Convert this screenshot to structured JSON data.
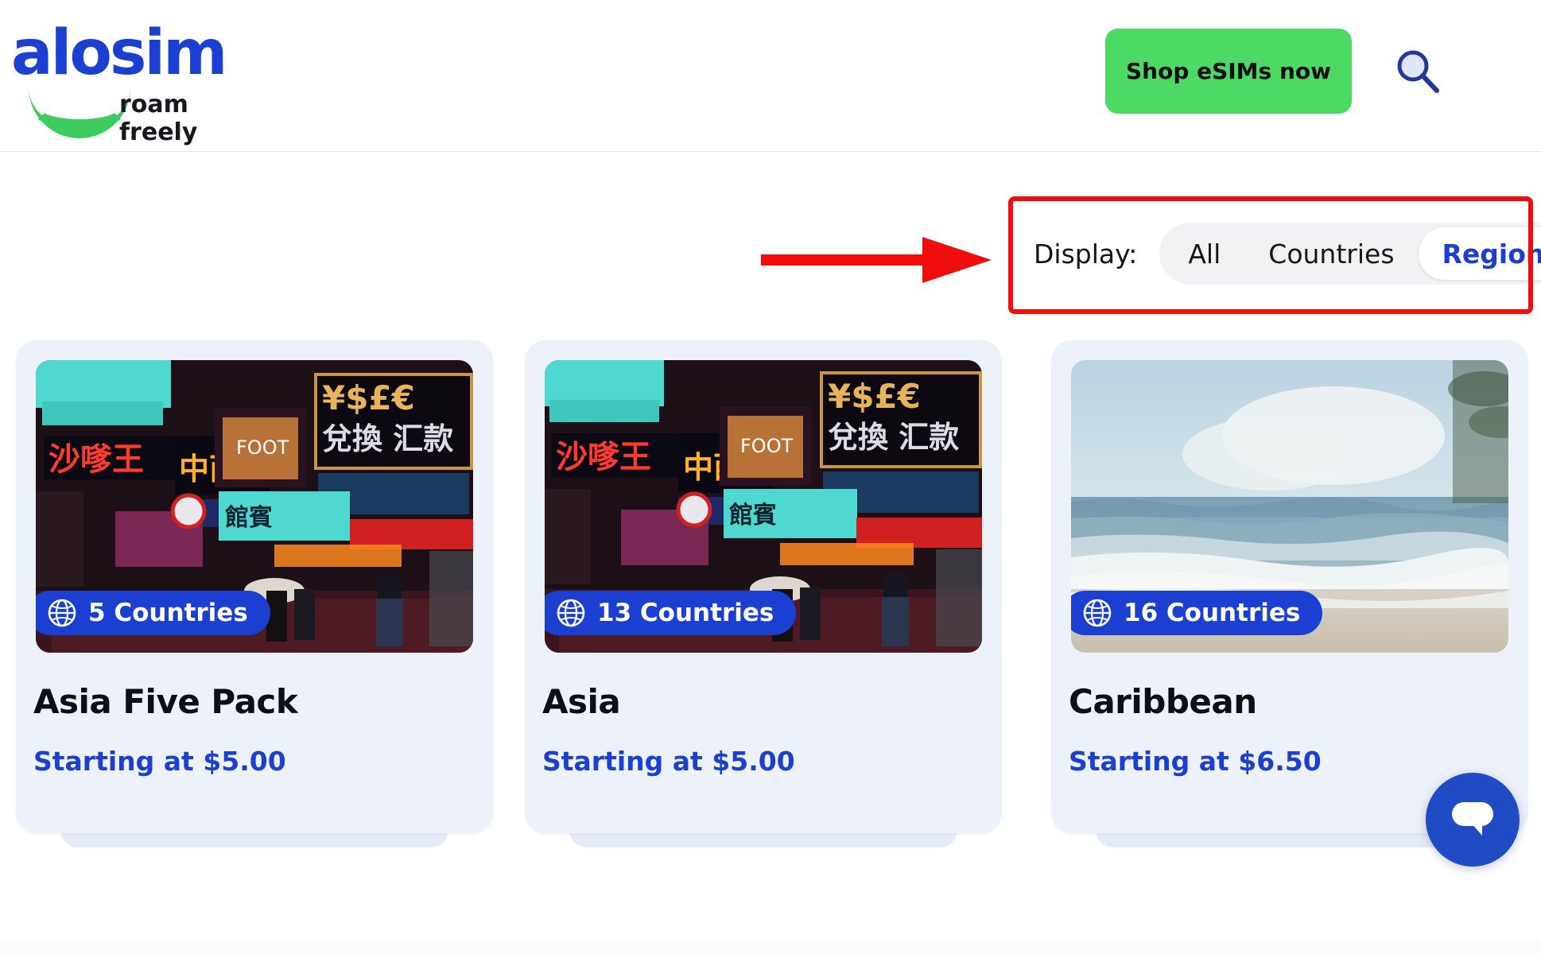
{
  "header": {
    "logo_word": "alosim",
    "logo_tagline": "roam freely",
    "shop_button": "Shop eSIMs now",
    "search_icon": "search-icon",
    "menu_icon": "hamburger-menu-icon"
  },
  "filter": {
    "label": "Display:",
    "options": [
      "All",
      "Countries",
      "Regions"
    ],
    "selected": "Regions",
    "annotation": {
      "arrow": "red-arrow-right",
      "highlight_color": "#f20d0d"
    }
  },
  "cards": [
    {
      "badge_count": "5 Countries",
      "title": "Asia Five Pack",
      "price": "Starting at $5.00",
      "image": "hong-kong-neon-street-signs",
      "badge_icon": "globe-icon"
    },
    {
      "badge_count": "13 Countries",
      "title": "Asia",
      "price": "Starting at $5.00",
      "image": "hong-kong-neon-street-signs",
      "badge_icon": "globe-icon"
    },
    {
      "badge_count": "16 Countries",
      "title": "Caribbean",
      "price": "Starting at $6.50",
      "image": "caribbean-beach-ocean-waves",
      "badge_icon": "globe-icon"
    }
  ],
  "chat": {
    "icon": "chat-bubble-icon"
  },
  "colors": {
    "brand_blue": "#1b3fd1",
    "brand_green": "#4cd964",
    "card_bg": "#edf1fa",
    "annotation_red": "#f20d0d"
  }
}
